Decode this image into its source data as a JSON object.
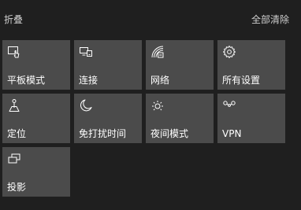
{
  "header": {
    "collapse_label": "折叠",
    "clear_all_label": "全部清除"
  },
  "tiles": [
    {
      "label": "平板模式",
      "icon": "tablet-mode-icon"
    },
    {
      "label": "连接",
      "icon": "connect-icon"
    },
    {
      "label": "网络",
      "icon": "network-icon"
    },
    {
      "label": "所有设置",
      "icon": "gear-icon"
    },
    {
      "label": "定位",
      "icon": "location-icon"
    },
    {
      "label": "免打扰时间",
      "icon": "moon-icon"
    },
    {
      "label": "夜间模式",
      "icon": "brightness-icon"
    },
    {
      "label": "VPN",
      "icon": "vpn-icon"
    },
    {
      "label": "投影",
      "icon": "project-icon"
    }
  ],
  "colors": {
    "background": "#1f1f1f",
    "tile": "#4b4b4b",
    "text": "#ffffff",
    "header_text": "#cfcfcf"
  }
}
